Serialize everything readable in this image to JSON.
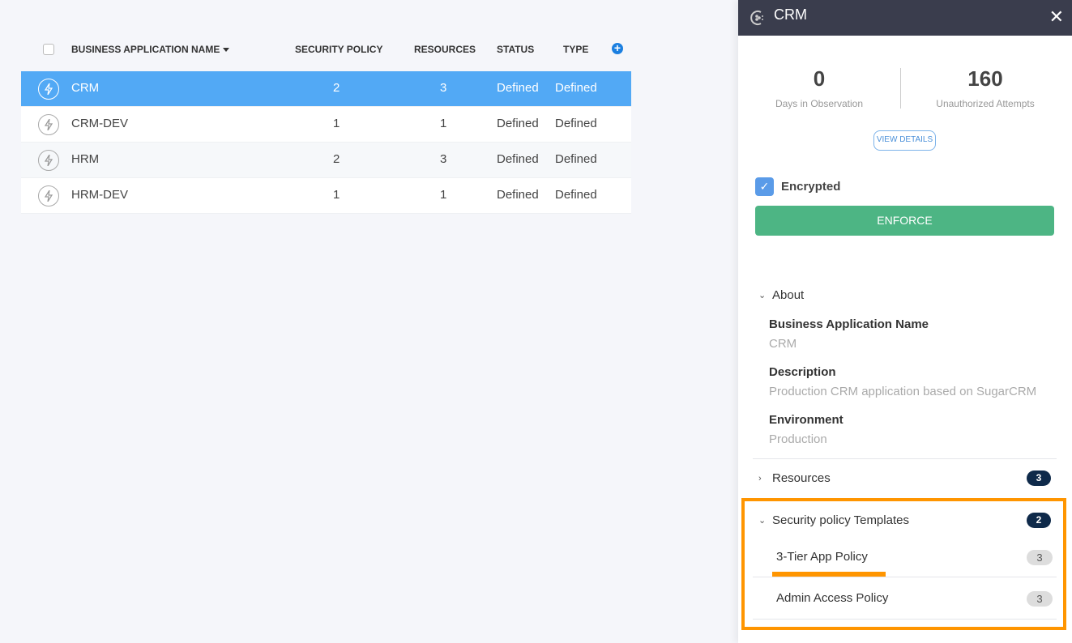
{
  "table": {
    "columns": {
      "name": "BUSINESS APPLICATION NAME",
      "security_policy": "SECURITY POLICY",
      "resources": "RESOURCES",
      "status": "STATUS",
      "type": "TYPE"
    },
    "rows": [
      {
        "name": "CRM",
        "security_policy": "2",
        "resources": "3",
        "status": "Defined",
        "type": "Defined",
        "selected": true
      },
      {
        "name": "CRM-DEV",
        "security_policy": "1",
        "resources": "1",
        "status": "Defined",
        "type": "Defined"
      },
      {
        "name": "HRM",
        "security_policy": "2",
        "resources": "3",
        "status": "Defined",
        "type": "Defined"
      },
      {
        "name": "HRM-DEV",
        "security_policy": "1",
        "resources": "1",
        "status": "Defined",
        "type": "Defined"
      }
    ],
    "selected_color": "#52a9f5"
  },
  "panel": {
    "title": "CRM",
    "stats": [
      {
        "value": "0",
        "label": "Days in Observation"
      },
      {
        "value": "160",
        "label": "Unauthorized Attempts"
      }
    ],
    "view_details": "VIEW DETAILS",
    "encrypted_label": "Encrypted",
    "encrypted_checked": true,
    "enforce_label": "ENFORCE",
    "enforce_color": "#4db584",
    "about": {
      "title": "About",
      "fields": [
        {
          "label": "Business Application Name",
          "value": "CRM"
        },
        {
          "label": "Description",
          "value": "Production CRM application based on SugarCRM"
        },
        {
          "label": "Environment",
          "value": "Production"
        }
      ]
    },
    "resources": {
      "title": "Resources",
      "count": "3"
    },
    "security_templates": {
      "title": "Security policy Templates",
      "count": "2",
      "items": [
        {
          "label": "3-Tier App Policy",
          "count": "3"
        },
        {
          "label": "Admin Access Policy",
          "count": "3"
        }
      ]
    },
    "highlight_color": "#ff9500"
  }
}
